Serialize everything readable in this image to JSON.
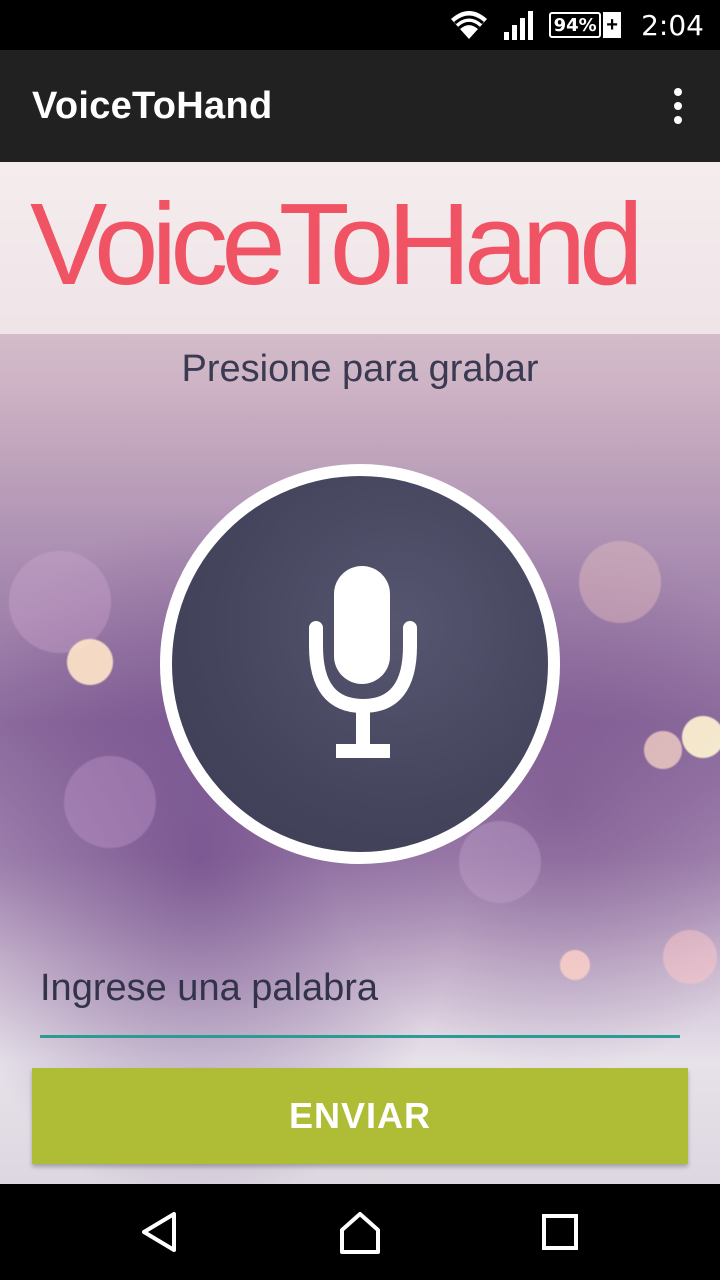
{
  "status_bar": {
    "battery_level": "94%",
    "time": "2:04",
    "icons": [
      "wifi-icon",
      "signal-icon",
      "battery-charging-icon"
    ]
  },
  "app_bar": {
    "title": "VoiceToHand",
    "menu_icon": "more-vert-icon"
  },
  "main": {
    "logo_text": "VoiceToHand",
    "prompt": "Presione para grabar",
    "record_icon": "microphone-icon",
    "word_input": {
      "placeholder": "Ingrese una palabra",
      "value": ""
    },
    "send_label": "ENVIAR"
  },
  "nav_bar": {
    "icons": [
      "back-icon",
      "home-icon",
      "recents-icon"
    ]
  },
  "colors": {
    "logo": "#f05364",
    "send_button": "#afbc36",
    "input_underline": "#2e9a94",
    "app_bar": "#212121",
    "record_button": "#45455e"
  }
}
